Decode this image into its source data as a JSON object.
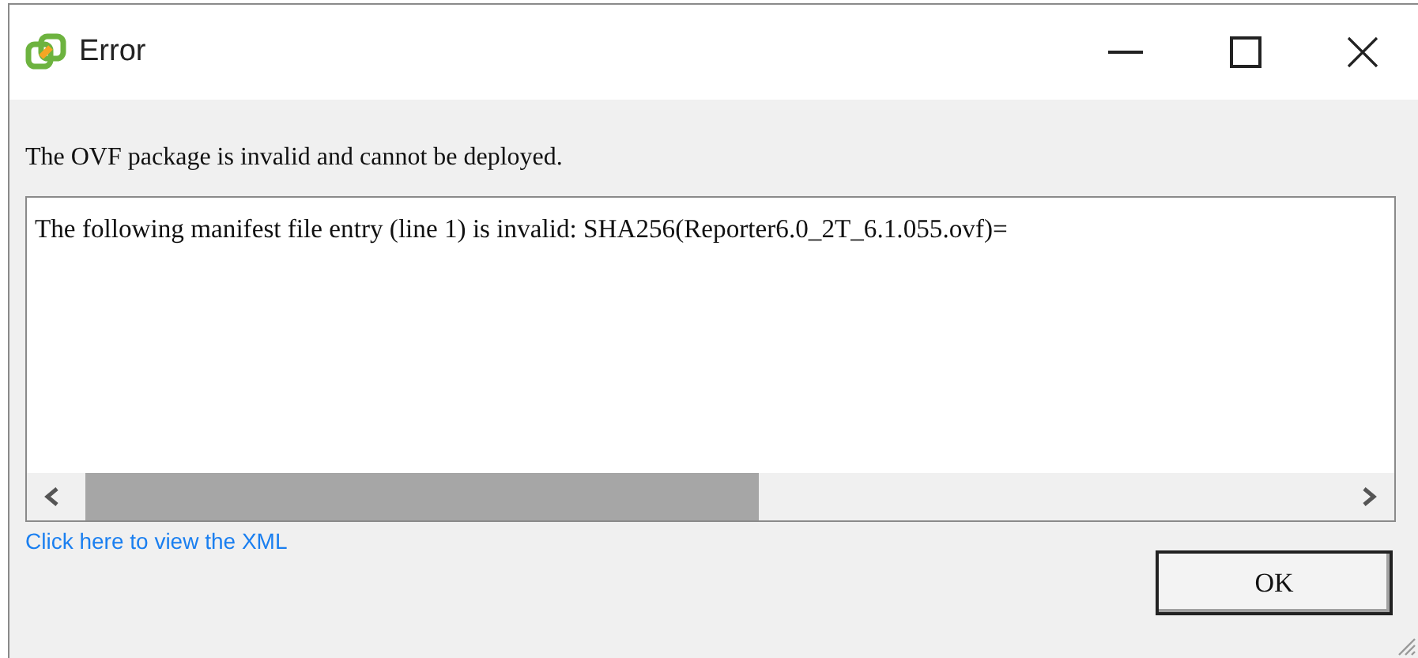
{
  "window": {
    "title": "Error"
  },
  "message": "The OVF package is invalid and cannot be deployed.",
  "details": {
    "text": "The following manifest file entry (line 1) is invalid: SHA256(Reporter6.0_2T_6.1.055.ovf)="
  },
  "link": "Click here to view the XML",
  "buttons": [
    "OK"
  ]
}
